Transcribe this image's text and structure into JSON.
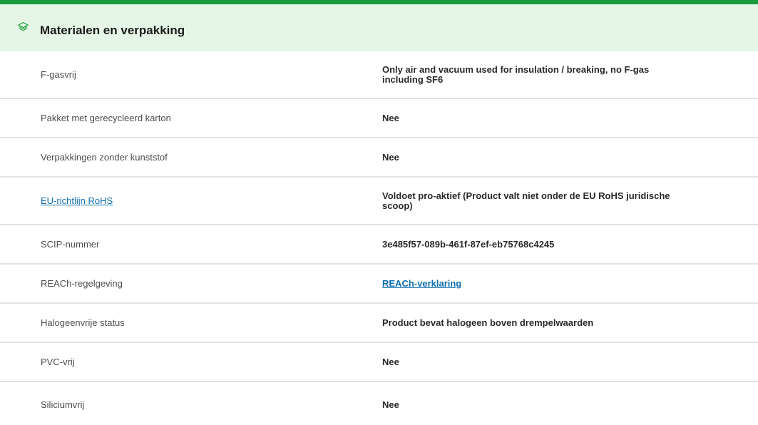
{
  "section": {
    "title": "Materialen en verpakking",
    "icon": "layers-icon",
    "accent_color": "#1c9b3a",
    "header_bg": "#e6f6e6"
  },
  "rows": [
    {
      "label": "F-gasvrij",
      "value": "Only air and vacuum used for insulation / breaking, no F-gas including SF6"
    },
    {
      "label": "Pakket met gerecycleerd karton",
      "value": "Nee"
    },
    {
      "label": "Verpakkingen zonder kunststof",
      "value": "Nee"
    },
    {
      "label": "EU-richtlijn RoHS",
      "value": "Voldoet pro-aktief (Product valt niet onder de EU RoHS juridische scoop)"
    },
    {
      "label": "SCIP-nummer",
      "value": "3e485f57-089b-461f-87ef-eb75768c4245"
    },
    {
      "label": "REACh-regelgeving",
      "value": "REACh-verklaring"
    },
    {
      "label": "Halogeenvrije status",
      "value": "Product bevat halogeen boven drempelwaarden"
    },
    {
      "label": "PVC-vrij",
      "value": "Nee"
    },
    {
      "label": "Siliciumvrij",
      "value": "Nee"
    }
  ]
}
